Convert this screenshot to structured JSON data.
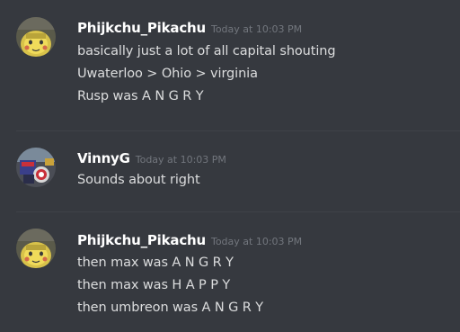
{
  "messages": [
    {
      "username": "Phijkchu_Pikachu",
      "timestamp": "Today at 10:03 PM",
      "avatar_icon": "pikachu-avatar",
      "lines": [
        "basically just a lot of all capital shouting",
        "Uwaterloo > Ohio > virginia",
        "Rusp was A N G R Y"
      ]
    },
    {
      "username": "VinnyG",
      "timestamp": "Today at 10:03 PM",
      "avatar_icon": "vinnyg-avatar",
      "lines": [
        "Sounds about right"
      ]
    },
    {
      "username": "Phijkchu_Pikachu",
      "timestamp": "Today at 10:03 PM",
      "avatar_icon": "pikachu-avatar",
      "lines": [
        "then max was A N G R Y",
        "then max was H A P P Y",
        "then umbreon was A N G R Y"
      ]
    }
  ],
  "colors": {
    "background": "#36393f",
    "username": "#ffffff",
    "timestamp": "#72767d",
    "message_text": "#dcddde",
    "divider": "#3f4248"
  }
}
